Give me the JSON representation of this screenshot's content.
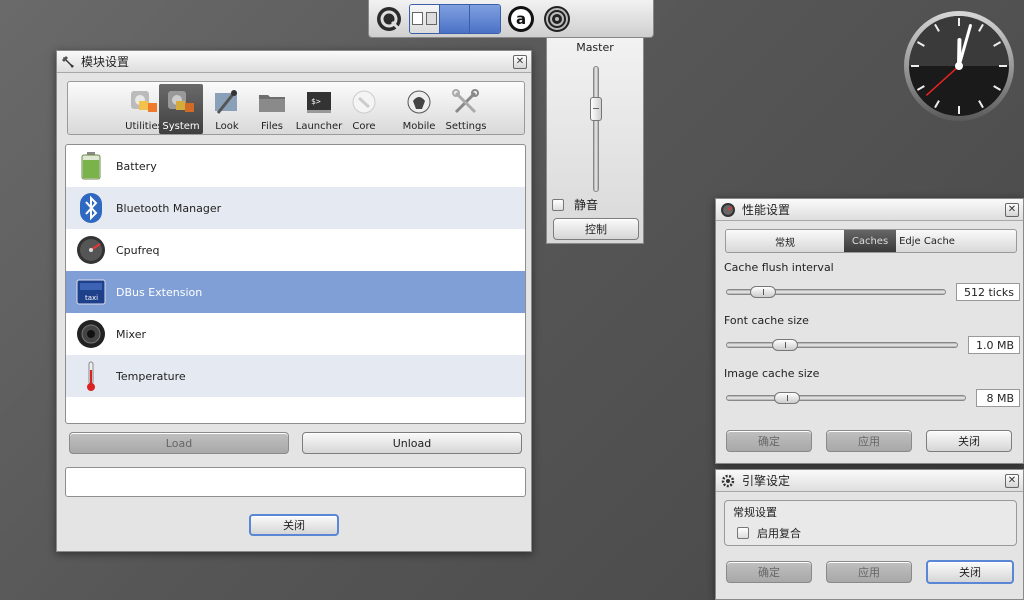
{
  "shelf": {
    "items": [
      "start-icon",
      "pager",
      "app-a-icon",
      "mixer-icon"
    ],
    "app_letter": "a"
  },
  "mixer": {
    "title": "Master",
    "volume_percent": 70,
    "mute_label": "静音",
    "mute_checked": false,
    "control_button": "控制"
  },
  "modules_window": {
    "title": "模块设置",
    "categories": [
      {
        "label": "Utilities",
        "icon": "utilities-icon",
        "selected": false
      },
      {
        "label": "System",
        "icon": "system-icon",
        "selected": true
      },
      {
        "label": "Look",
        "icon": "look-icon",
        "selected": false
      },
      {
        "label": "Files",
        "icon": "files-icon",
        "selected": false
      },
      {
        "label": "Launcher",
        "icon": "launcher-icon",
        "selected": false
      },
      {
        "label": "Core",
        "icon": "core-icon",
        "selected": false
      },
      {
        "label": "Mobile",
        "icon": "mobile-icon",
        "selected": false
      },
      {
        "label": "Settings",
        "icon": "settings-icon",
        "selected": false
      }
    ],
    "modules": [
      {
        "name": "Battery",
        "icon": "battery-icon",
        "selected": false
      },
      {
        "name": "Bluetooth Manager",
        "icon": "bluetooth-icon",
        "selected": false
      },
      {
        "name": "Cpufreq",
        "icon": "cpufreq-icon",
        "selected": false
      },
      {
        "name": "DBus Extension",
        "icon": "dbus-icon",
        "selected": true
      },
      {
        "name": "Mixer",
        "icon": "speaker-icon",
        "selected": false
      },
      {
        "name": "Temperature",
        "icon": "thermometer-icon",
        "selected": false
      }
    ],
    "load_button": "Load",
    "unload_button": "Unload",
    "status_text": "",
    "close_button": "关闭"
  },
  "perf_window": {
    "title": "性能设置",
    "tabs": [
      "常规",
      "Caches",
      "Edje Cache"
    ],
    "active_tab": "Caches",
    "cache_flush_label": "Cache flush interval",
    "cache_flush_value": "512 ticks",
    "cache_flush_fraction": 0.12,
    "font_cache_label": "Font cache size",
    "font_cache_value": "1.0 MB",
    "font_cache_fraction": 0.22,
    "image_cache_label": "Image cache size",
    "image_cache_value": "8 MB",
    "image_cache_fraction": 0.22,
    "ok_button": "确定",
    "apply_button": "应用",
    "close_button": "关闭"
  },
  "engine_window": {
    "title": "引擎设定",
    "group_label": "常规设置",
    "composite_label": "启用复合",
    "composite_checked": false,
    "ok_button": "确定",
    "apply_button": "应用",
    "close_button": "关闭"
  },
  "clock": {
    "hour": 12,
    "minute": 2,
    "second": 38
  }
}
